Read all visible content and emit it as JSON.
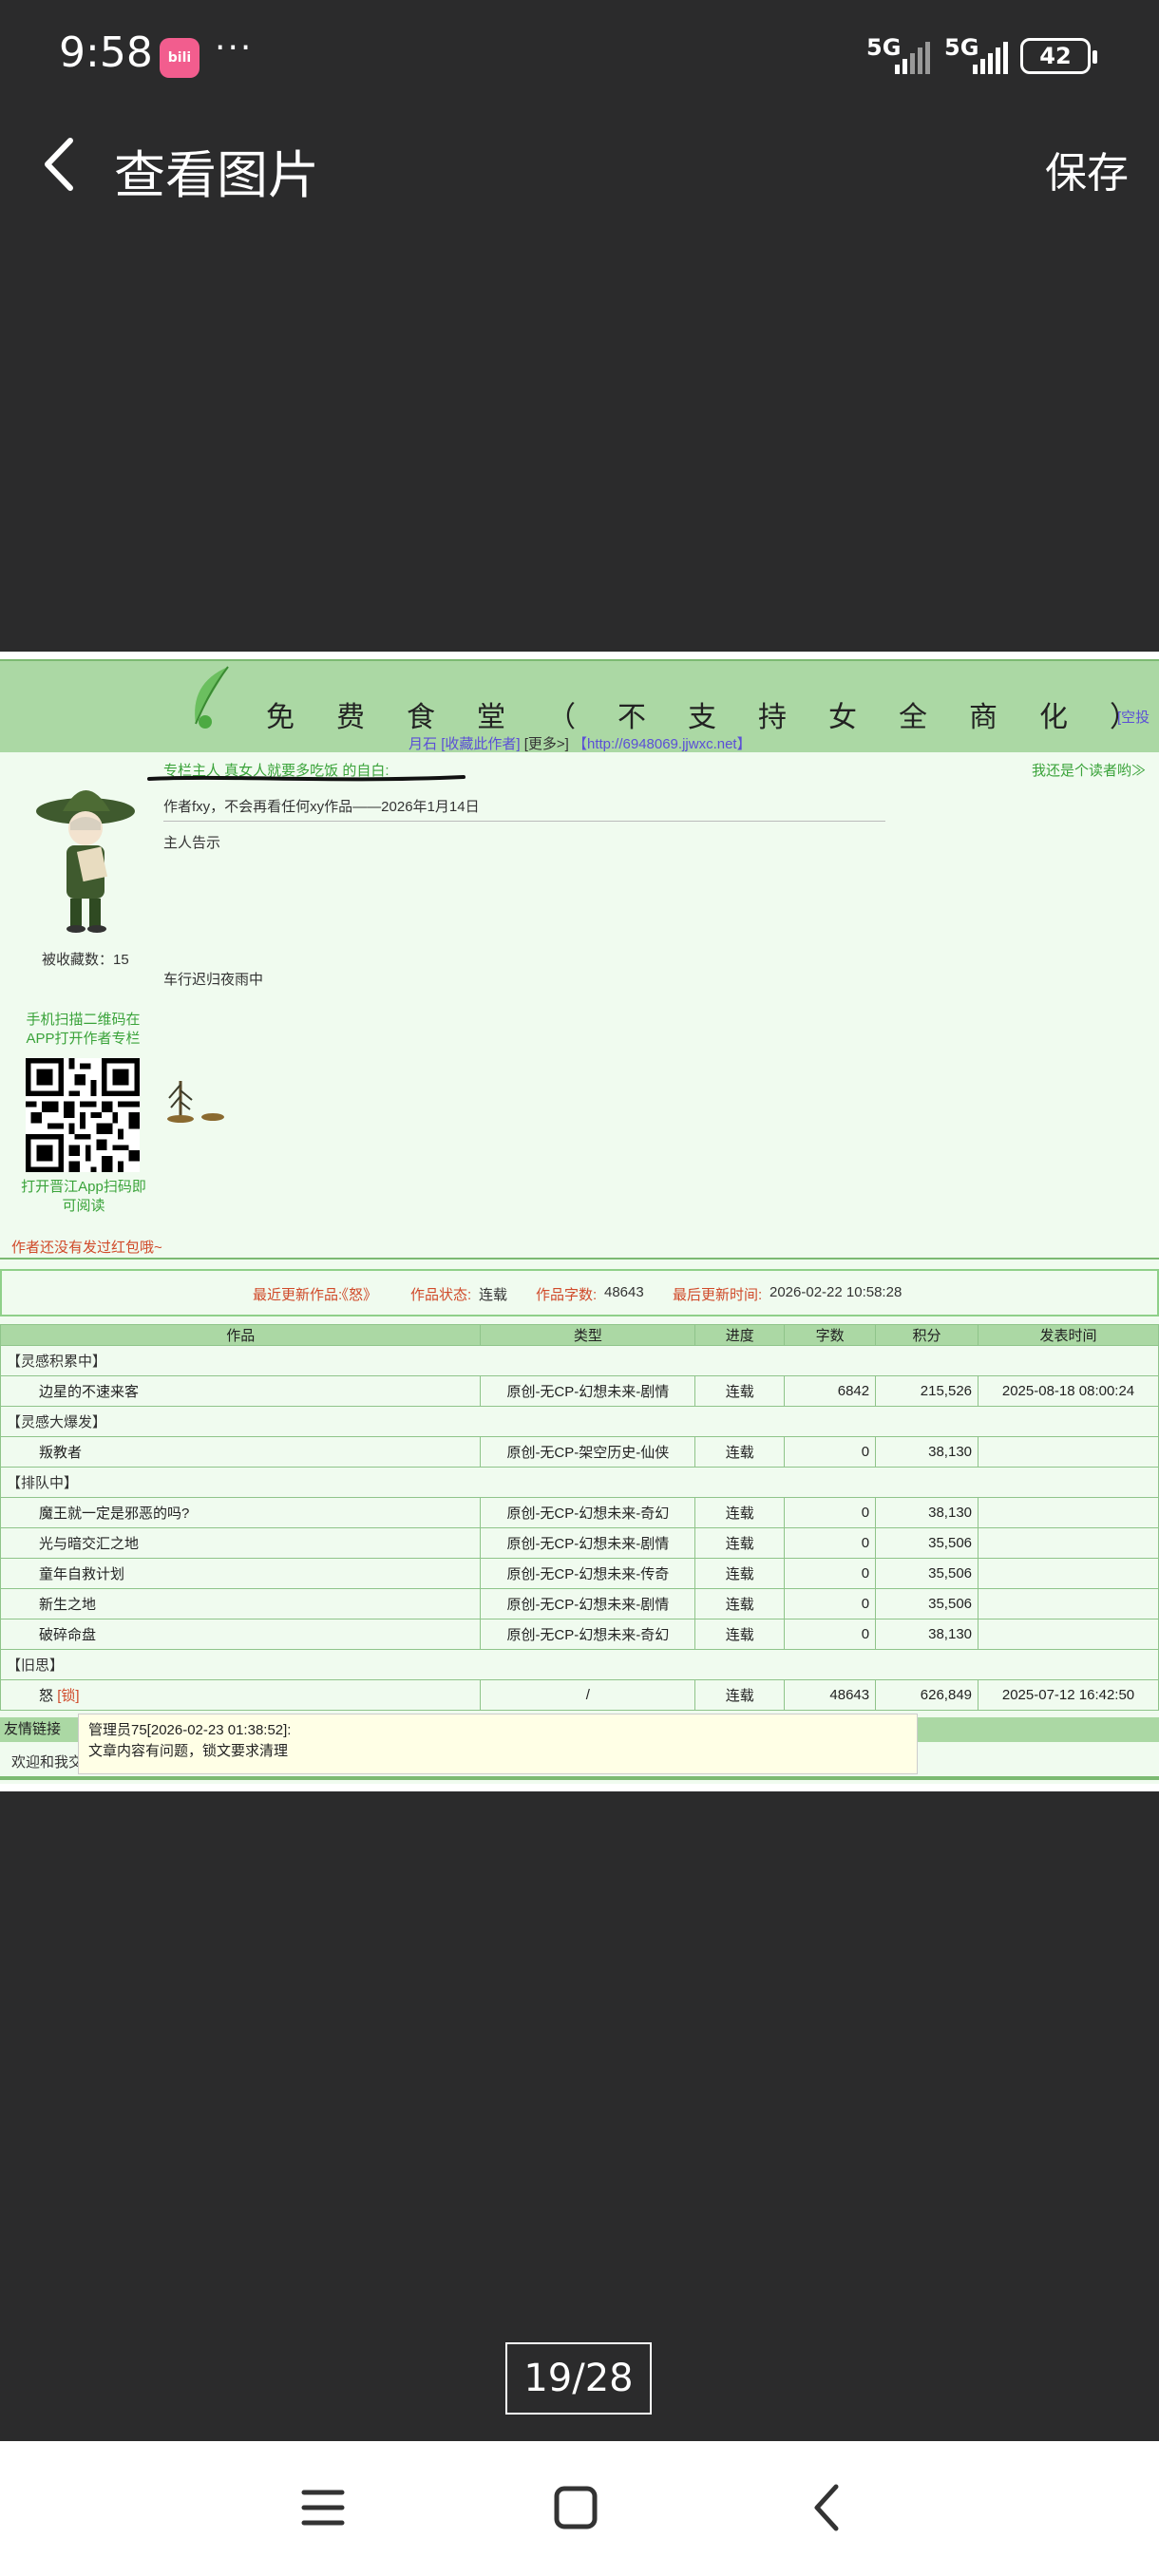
{
  "status_bar": {
    "time": "9:58",
    "app_badge": "bili",
    "overflow": "···",
    "signal1": "5G",
    "signal2": "5G",
    "battery": "42"
  },
  "header": {
    "title": "查看图片",
    "save_label": "保存"
  },
  "screenshot": {
    "site_title": "免费食堂（不支持女全商化）",
    "header_right": "[空投",
    "header_links": {
      "moonstone": "月石",
      "bookmark": "[收藏此作者]",
      "more": "[更多>]",
      "url": "【http://6948069.jjwxc.net】"
    },
    "owner_line": "专栏主人 真女人就要多吃饭 的自白:",
    "reader_link": "我还是个读者哟≫",
    "notice1": "作者fxy，不会再看任何xy作品——2026年1月14日",
    "notice2": "主人告示",
    "notice3": "车行迟归夜雨中",
    "fav_count": "被收藏数：15",
    "scan_tip": "手机扫描二维码在APP打开作者专栏",
    "open_tip": "打开晋江App扫码即可阅读",
    "redpack": "作者还没有发过红包哦~",
    "latest": {
      "latest_label": "最近更新作品:",
      "latest_value": "《怒》",
      "state_label": "作品状态:",
      "state_value": "连载",
      "words_label": "作品字数:",
      "words_value": "48643",
      "time_label": "最后更新时间:",
      "time_value": "2026-02-22 10:58:28"
    },
    "table_headers": {
      "work": "作品",
      "type": "类型",
      "progress": "进度",
      "words": "字数",
      "score": "积分",
      "pubtime": "发表时间"
    },
    "groups": {
      "g1": "【灵感积累中】",
      "g2": "【灵感大爆发】",
      "g3": "【排队中】",
      "g4": "【旧思】"
    },
    "rows": [
      {
        "title": "边星的不速来客",
        "type": "原创-无CP-幻想未来-剧情",
        "progress": "连载",
        "words": "6842",
        "score": "215,526",
        "time": "2025-08-18 08:00:24"
      },
      {
        "title": "叛教者",
        "type": "原创-无CP-架空历史-仙侠",
        "progress": "连载",
        "words": "0",
        "score": "38,130",
        "time": ""
      },
      {
        "title": "魔王就一定是邪恶的吗?",
        "type": "原创-无CP-幻想未来-奇幻",
        "progress": "连载",
        "words": "0",
        "score": "38,130",
        "time": ""
      },
      {
        "title": "光与暗交汇之地",
        "type": "原创-无CP-幻想未来-剧情",
        "progress": "连载",
        "words": "0",
        "score": "35,506",
        "time": ""
      },
      {
        "title": "童年自救计划",
        "type": "原创-无CP-幻想未来-传奇",
        "progress": "连载",
        "words": "0",
        "score": "35,506",
        "time": ""
      },
      {
        "title": "新生之地",
        "type": "原创-无CP-幻想未来-剧情",
        "progress": "连载",
        "words": "0",
        "score": "35,506",
        "time": ""
      },
      {
        "title": "破碎命盘",
        "type": "原创-无CP-幻想未来-奇幻",
        "progress": "连载",
        "words": "0",
        "score": "38,130",
        "time": ""
      },
      {
        "title": "怒",
        "lock": "[锁]",
        "type": "/",
        "progress": "连载",
        "words": "48643",
        "score": "626,849",
        "time": "2025-07-12 16:42:50"
      }
    ],
    "friends_label": "友情链接",
    "friends_text": "欢迎和我交",
    "tooltip": {
      "line1": "管理员75[2026-02-23 01:38:52]:",
      "line2": "文章内容有问题，锁文要求清理"
    }
  },
  "counter": "19/28",
  "colors": {
    "background": "#2b2b2c",
    "page_green": "#f0fbef",
    "header_green": "#abd8a4",
    "link_green": "#3aa33a",
    "link_purple": "#5b4fd6",
    "warning_red": "#d04a2a"
  }
}
